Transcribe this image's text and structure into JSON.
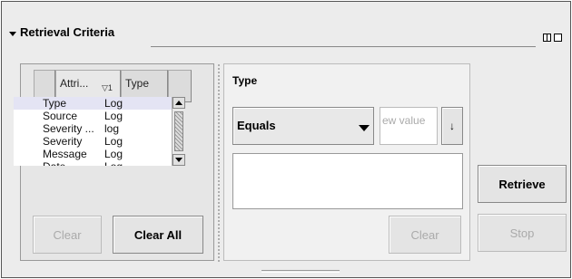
{
  "section": {
    "title": "Retrieval Criteria"
  },
  "table": {
    "columns": [
      "Attri...",
      "Type"
    ],
    "sort_indicator": "▽1",
    "rows": [
      {
        "attribute": "Type",
        "type": "Log",
        "selected": true
      },
      {
        "attribute": "Source",
        "type": "Log"
      },
      {
        "attribute": "Severity ...",
        "type": "log"
      },
      {
        "attribute": "Severity",
        "type": "Log"
      },
      {
        "attribute": "Message",
        "type": "Log"
      },
      {
        "attribute": "Date",
        "type": "Log"
      }
    ]
  },
  "left_buttons": {
    "clear": "Clear",
    "clear_all": "Clear All"
  },
  "filter": {
    "label": "Type",
    "operator": "Equals",
    "new_value_placeholder": "ew value",
    "sort_button": "↓",
    "clear": "Clear"
  },
  "actions": {
    "retrieve": "Retrieve",
    "stop": "Stop"
  },
  "icons": {
    "collapse": "triangle-down-icon",
    "window_a": "panel-split-icon",
    "window_b": "maximize-icon"
  }
}
